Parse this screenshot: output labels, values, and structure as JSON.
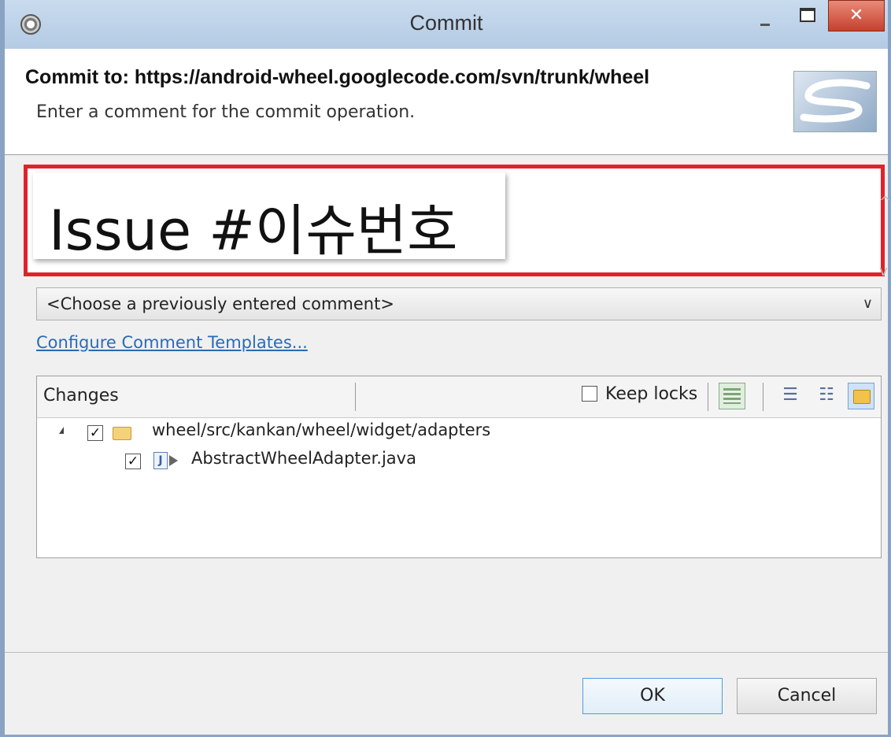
{
  "window": {
    "title": "Commit"
  },
  "header": {
    "commit_to": "Commit to: https://android-wheel.googlecode.com/svn/trunk/wheel",
    "subtitle": "Enter a comment for the commit operation."
  },
  "comment": {
    "text": "Issue #이슈번호",
    "highlight_color": "#e0232a"
  },
  "history": {
    "selected": "<Choose a previously entered comment>"
  },
  "templates_link": "Configure Comment Templates...",
  "changes": {
    "label": "Changes",
    "keep_locks_label": "Keep locks",
    "keep_locks_checked": false,
    "tree": [
      {
        "path": "wheel/src/kankan/wheel/widget/adapters",
        "checked": true,
        "icon": "folder-open-icon"
      },
      {
        "path": "AbstractWheelAdapter.java",
        "checked": true,
        "icon": "java-file-icon"
      }
    ]
  },
  "buttons": {
    "ok": "OK",
    "cancel": "Cancel"
  },
  "colors": {
    "titlebar": "#b4cbe4",
    "close_button": "#c7402c",
    "link": "#2a6bb5"
  }
}
